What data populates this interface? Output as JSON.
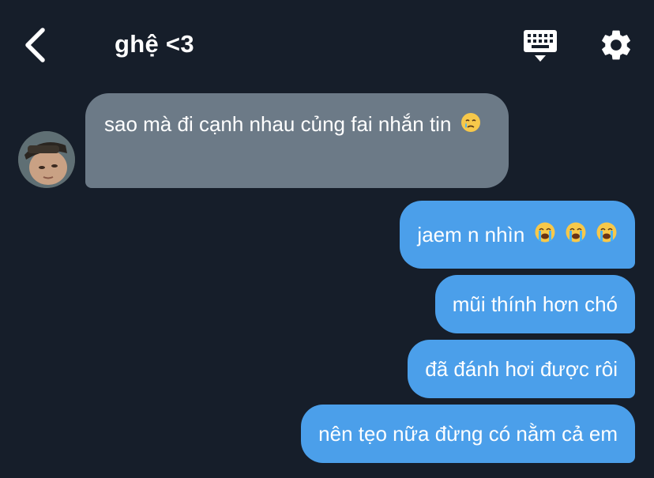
{
  "header": {
    "title": "ghệ <3"
  },
  "messages": {
    "incoming": [
      {
        "text": "sao mà đi cạnh nhau củng fai nhắn tin",
        "emoji": "crying-face-icon"
      }
    ],
    "outgoing": [
      {
        "text": "jaem n nhìn",
        "emoji": [
          "loudly-crying-face-icon",
          "loudly-crying-face-icon",
          "loudly-crying-face-icon"
        ]
      },
      {
        "text": "mũi thính hơn chó"
      },
      {
        "text": "đã đánh hơi được rôi"
      },
      {
        "text": "nên tẹo nữa đừng có nằm cả em"
      }
    ]
  },
  "colors": {
    "background": "#161e2a",
    "incoming_bubble": "#6c7a87",
    "outgoing_bubble": "#4b9fea",
    "text": "#ffffff"
  },
  "icons": [
    "back-icon",
    "keyboard-icon",
    "gear-icon"
  ]
}
